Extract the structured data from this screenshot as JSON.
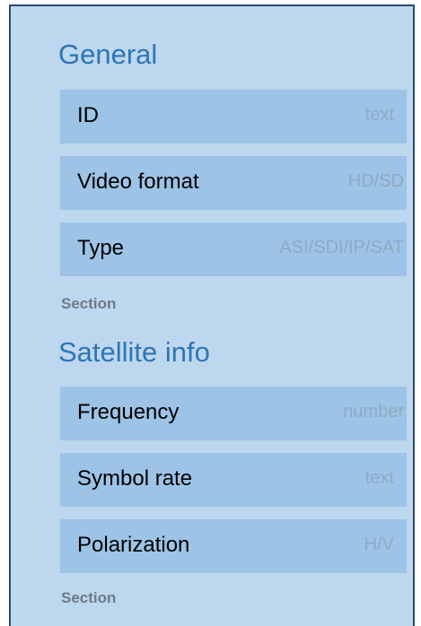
{
  "sections": [
    {
      "title": "General",
      "fields": [
        {
          "label": "ID",
          "type": "text"
        },
        {
          "label": "Video format",
          "type": "HD/SD"
        },
        {
          "label": "Type",
          "type": "ASI/SDI/IP/SAT"
        }
      ],
      "footer": "Section"
    },
    {
      "title": "Satellite info",
      "fields": [
        {
          "label": "Frequency",
          "type": "number"
        },
        {
          "label": "Symbol rate",
          "type": "text"
        },
        {
          "label": "Polarization",
          "type": "H/V"
        }
      ],
      "footer": "Section"
    }
  ]
}
